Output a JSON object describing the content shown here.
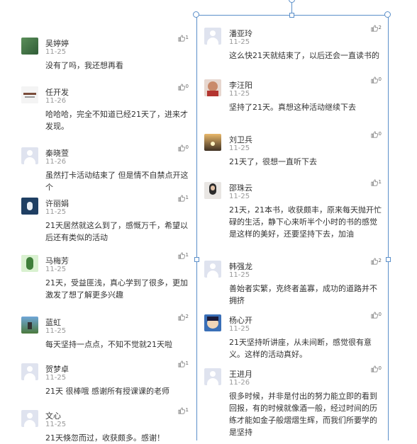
{
  "left_comments": [
    {
      "name": "吴婷婷",
      "date": "11-25",
      "likes": "1",
      "text": "没有了吗，我还想再看",
      "avatar": "green-leaf"
    },
    {
      "name": "任开发",
      "date": "11-26",
      "likes": "0",
      "text": "哈哈哈，完全不知道已经21天了，进来才发现。",
      "avatar": "logo"
    },
    {
      "name": "秦晓萱",
      "date": "11-26",
      "likes": "0",
      "text": "虽然打卡活动结束了 但是情不自禁点开这个",
      "avatar": "placeholder"
    },
    {
      "name": "许丽娟",
      "date": "11-25",
      "likes": "1",
      "text": "21天居然就这么到了，感慨万千，希望以后还有类似的活动",
      "avatar": "penguin"
    },
    {
      "name": "马梅芳",
      "date": "11-25",
      "likes": "1",
      "text": "21天，受益匪浅，真心学到了很多，更加激发了想了解更多兴趣",
      "avatar": "cactus"
    },
    {
      "name": "蓝虹",
      "date": "11-25",
      "likes": "2",
      "text": "每天坚持一点点，不知不觉就21天啦",
      "avatar": "scene"
    },
    {
      "name": "贺梦卓",
      "date": "11-25",
      "likes": "1",
      "text": "21天 很棒哦 感谢所有授课课的老师",
      "avatar": "placeholder"
    },
    {
      "name": "文心",
      "date": "11-25",
      "likes": "1",
      "text": "21天倏忽而过，收获颇多。感谢！",
      "avatar": "placeholder"
    }
  ],
  "right_comments": [
    {
      "name": "潘亚玲",
      "date": "11-25",
      "likes": "2",
      "text": "这么快21天就结束了，以后还会一直读书的",
      "avatar": "placeholder"
    },
    {
      "name": "李汪阳",
      "date": "11-25",
      "likes": "0",
      "text": "坚持了21天。真想这种活动继续下去",
      "avatar": "girl"
    },
    {
      "name": "刘卫兵",
      "date": "11-25",
      "likes": "0",
      "text": "21天了，很想一直听下去",
      "avatar": "sunset"
    },
    {
      "name": "邵珠云",
      "date": "11-25",
      "likes": "1",
      "text": "21天，21本书，收获颇丰，原来每天抛开忙碌的生活，静下心来听半个小时的书的感觉是这样的美好，还要坚持下去，加油",
      "avatar": "person"
    },
    {
      "name": "韩强龙",
      "date": "11-25",
      "likes": "2",
      "text": "善始者实繁，克终者盖寡，成功的道路并不拥挤",
      "avatar": "placeholder"
    },
    {
      "name": "杨心开",
      "date": "11-25",
      "likes": "0",
      "text": "21天坚持听讲座，从未间断，感觉很有意义。这样的活动真好。",
      "avatar": "cartoon"
    },
    {
      "name": "王进月",
      "date": "11-26",
      "likes": "0",
      "text": "很多时候，并非是付出的努力能立即的看到回报，有的时候就像酒一般，经过时间的历练才能如金子般熠熠生辉，而我们所要学的是坚持",
      "avatar": "placeholder"
    }
  ]
}
